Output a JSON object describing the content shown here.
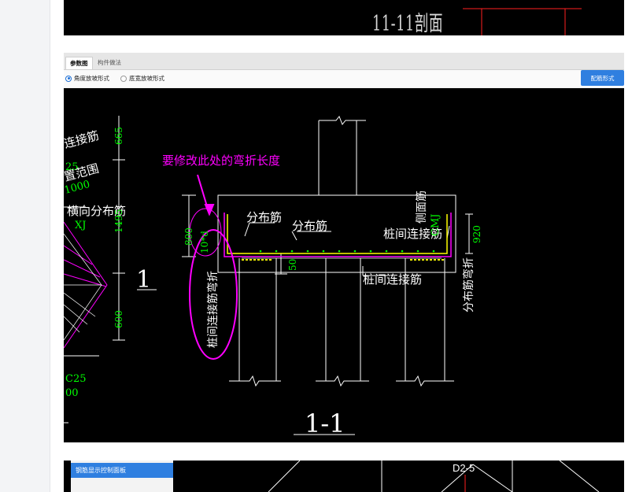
{
  "top_image": {
    "section_title": "11-11剖面"
  },
  "panel": {
    "tabs": [
      {
        "label": "参数图"
      },
      {
        "label": "构件做法"
      }
    ],
    "options": [
      {
        "label": "角度放坡形式",
        "selected": true
      },
      {
        "label": "底宽放坡形式",
        "selected": false
      }
    ],
    "rebar_form_button": "配筋形式"
  },
  "drawing": {
    "annotation": "要修改此处的弯折长度",
    "labels": {
      "pile_connect_1": "连接筋",
      "c25_top": "25",
      "layout_range": "置范围",
      "layout_val": "1000",
      "transverse_dist": "横向分布筋",
      "xj": "XJ",
      "section_mark": "1",
      "bottom_c25": "C25",
      "bottom_00": "00",
      "dist_bar_1": "分布筋",
      "dist_bar_2": "分布筋",
      "pile_between_bar": "桩间连接筋",
      "pile_between_bar_2": "桩间连接筋",
      "pile_bend": "桩间连接筋弯折",
      "side_bar": "侧面筋",
      "cmj": "CMJ",
      "dist_bend": "分布筋弯折",
      "bend_formula": "10*d",
      "dim_800": "800",
      "dim_50": "50",
      "dim_920": "920",
      "dim_665": "665",
      "dim_1495": "1495",
      "dim_600": "600",
      "section_title": "1-1"
    }
  },
  "bottom_image": {
    "panel_title": "钢筋显示控制面板",
    "label": "D2-5"
  },
  "colors": {
    "canvas_bg": "#000000",
    "green_dim": "#00ff00",
    "magenta": "#ff00ff",
    "yellow": "#ffff00",
    "cyan": "#00ffff",
    "white": "#ffffff",
    "red": "#ff2020",
    "accent": "#2f7fe0"
  }
}
